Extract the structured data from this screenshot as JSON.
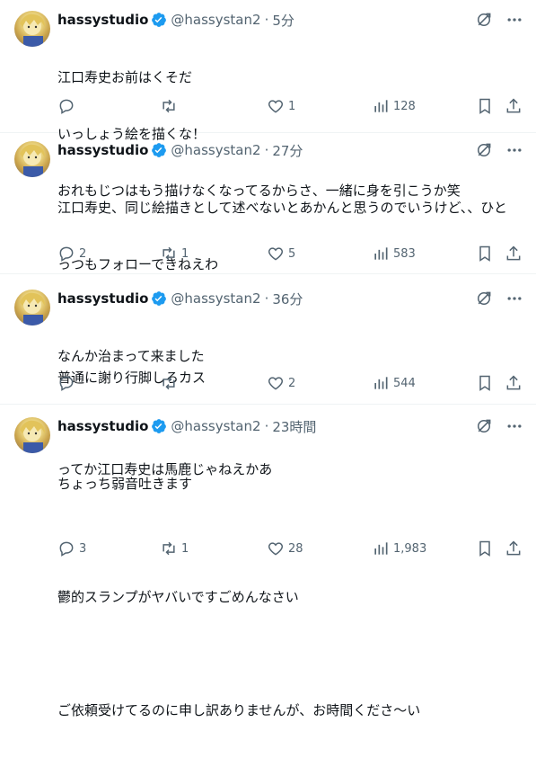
{
  "tweets": [
    {
      "name": "hassystudio",
      "handle": "@hassystan2",
      "time": "5分",
      "lines": [
        "江口寿史お前はくそだ",
        "いっしょう絵を描くな！",
        "おれもじつはもう描けなくなってるからさ、一緒に身を引こうか笑"
      ],
      "replies": "",
      "retweets": "",
      "likes": "1",
      "views": "128"
    },
    {
      "name": "hassystudio",
      "handle": "@hassystan2",
      "time": "27分",
      "lines": [
        "江口寿史、同じ絵描きとして述べないとあかんと思うのでいうけど、、ひと",
        "っつもフォローできねえわ",
        "",
        "普通に謝り行脚しろカス"
      ],
      "replies": "2",
      "retweets": "1",
      "likes": "5",
      "views": "583"
    },
    {
      "name": "hassystudio",
      "handle": "@hassystan2",
      "time": "36分",
      "lines": [
        "なんか治まって来ました",
        "",
        "ってか江口寿史は馬鹿じゃねえかあ"
      ],
      "replies": "",
      "retweets": "",
      "likes": "2",
      "views": "544"
    },
    {
      "name": "hassystudio",
      "handle": "@hassystan2",
      "time": "23時間",
      "lines": [
        "ちょっち弱音吐きます",
        "",
        "鬱的スランプがヤバいですごめんなさい",
        "",
        "ご依頼受けてるのに申し訳ありませんが、お時間くださ〜い"
      ],
      "replies": "3",
      "retweets": "1",
      "likes": "28",
      "views": "1,983"
    }
  ],
  "colors": {
    "text": "#0f1419",
    "muted": "#536471",
    "verified": "#1d9bf0",
    "divider": "#eff3f4"
  },
  "icons": [
    "verified-badge-icon",
    "grok-icon",
    "more-icon",
    "reply-icon",
    "retweet-icon",
    "like-icon",
    "views-icon",
    "bookmark-icon",
    "share-icon"
  ]
}
